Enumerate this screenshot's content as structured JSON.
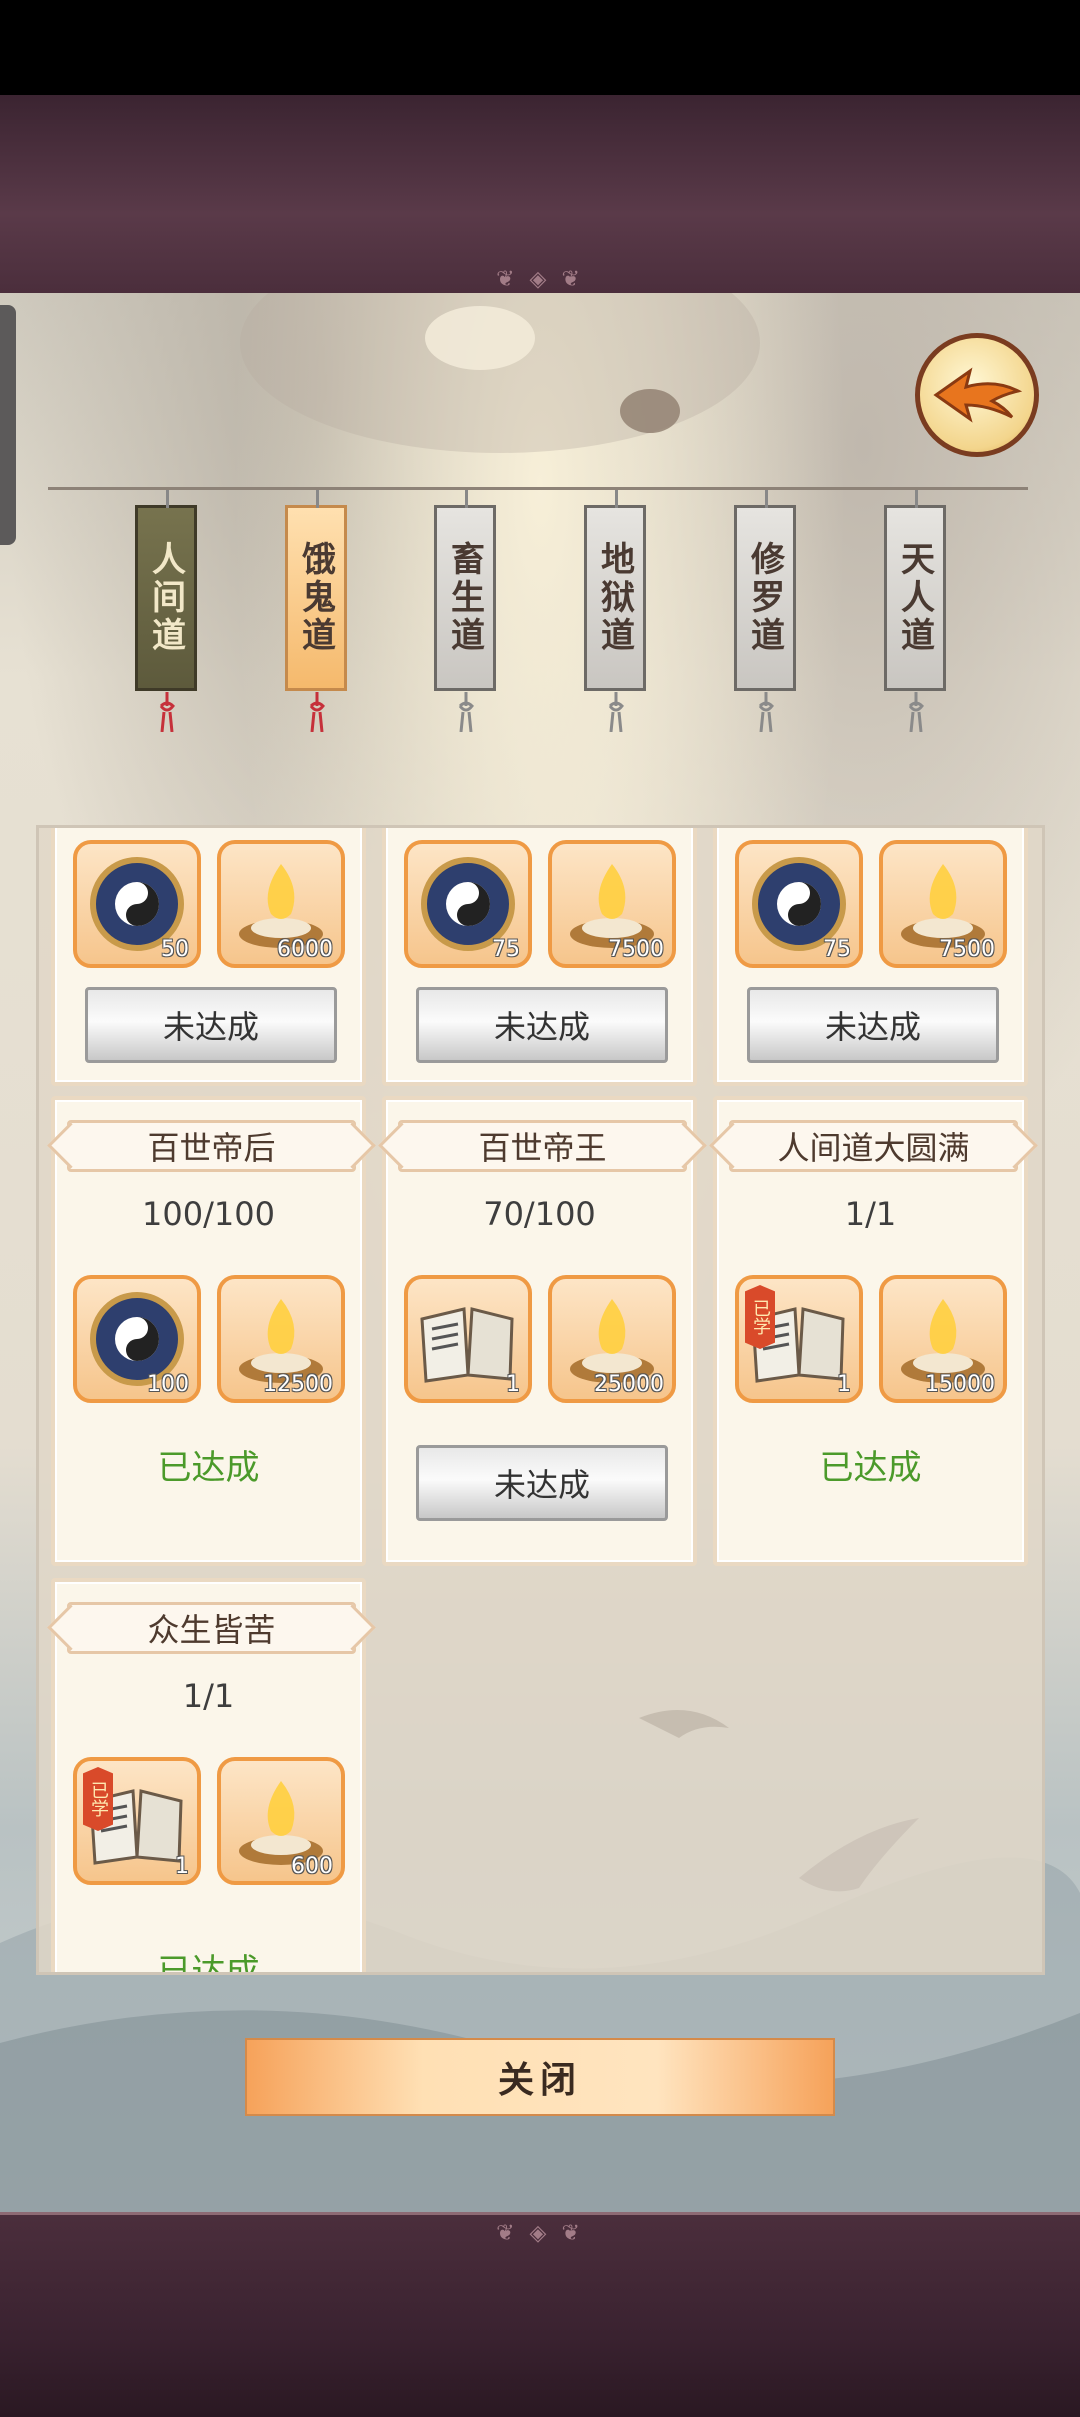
{
  "nav": {
    "tabs": [
      {
        "label": "人间道",
        "state": "active"
      },
      {
        "label": "饿鬼道",
        "state": "highlight"
      },
      {
        "label": "畜生道",
        "state": "normal"
      },
      {
        "label": "地狱道",
        "state": "normal"
      },
      {
        "label": "修罗道",
        "state": "normal"
      },
      {
        "label": "天人道",
        "state": "normal"
      }
    ]
  },
  "cards": {
    "row1": [
      {
        "title": "",
        "progress": "",
        "rewards": [
          {
            "icon": "yin-yang-compass-icon",
            "qty": "50"
          },
          {
            "icon": "incense-burner-icon",
            "qty": "6000"
          }
        ],
        "status": "未达成",
        "achieved": false
      },
      {
        "title": "",
        "progress": "",
        "rewards": [
          {
            "icon": "yin-yang-compass-icon",
            "qty": "75"
          },
          {
            "icon": "incense-burner-icon",
            "qty": "7500"
          }
        ],
        "status": "未达成",
        "achieved": false
      },
      {
        "title": "",
        "progress": "",
        "rewards": [
          {
            "icon": "yin-yang-compass-icon",
            "qty": "75"
          },
          {
            "icon": "incense-burner-icon",
            "qty": "7500"
          }
        ],
        "status": "未达成",
        "achieved": false
      }
    ],
    "row2": [
      {
        "title": "百世帝后",
        "progress": "100/100",
        "rewards": [
          {
            "icon": "yin-yang-compass-icon",
            "qty": "100"
          },
          {
            "icon": "incense-burner-icon",
            "qty": "12500"
          }
        ],
        "status": "已达成",
        "achieved": true
      },
      {
        "title": "百世帝王",
        "progress": "70/100",
        "rewards": [
          {
            "icon": "skill-book-icon",
            "qty": "1"
          },
          {
            "icon": "incense-burner-icon",
            "qty": "25000"
          }
        ],
        "status": "未达成",
        "achieved": false
      },
      {
        "title": "人间道大圆满",
        "progress": "1/1",
        "rewards": [
          {
            "icon": "skill-book-icon",
            "qty": "1",
            "badge": "已学"
          },
          {
            "icon": "incense-burner-icon",
            "qty": "15000"
          }
        ],
        "status": "已达成",
        "achieved": true
      }
    ],
    "row3": [
      {
        "title": "众生皆苦",
        "progress": "1/1",
        "rewards": [
          {
            "icon": "skill-book-icon",
            "qty": "1",
            "badge": "已学"
          },
          {
            "icon": "incense-burner-icon",
            "qty": "600"
          }
        ],
        "status": "已达成",
        "achieved": true
      }
    ]
  },
  "close_label": "关闭",
  "colors": {
    "achieved": "#4b9a2a",
    "slot_border": "#ef9a44",
    "active_tab": "#5d5a3c"
  }
}
